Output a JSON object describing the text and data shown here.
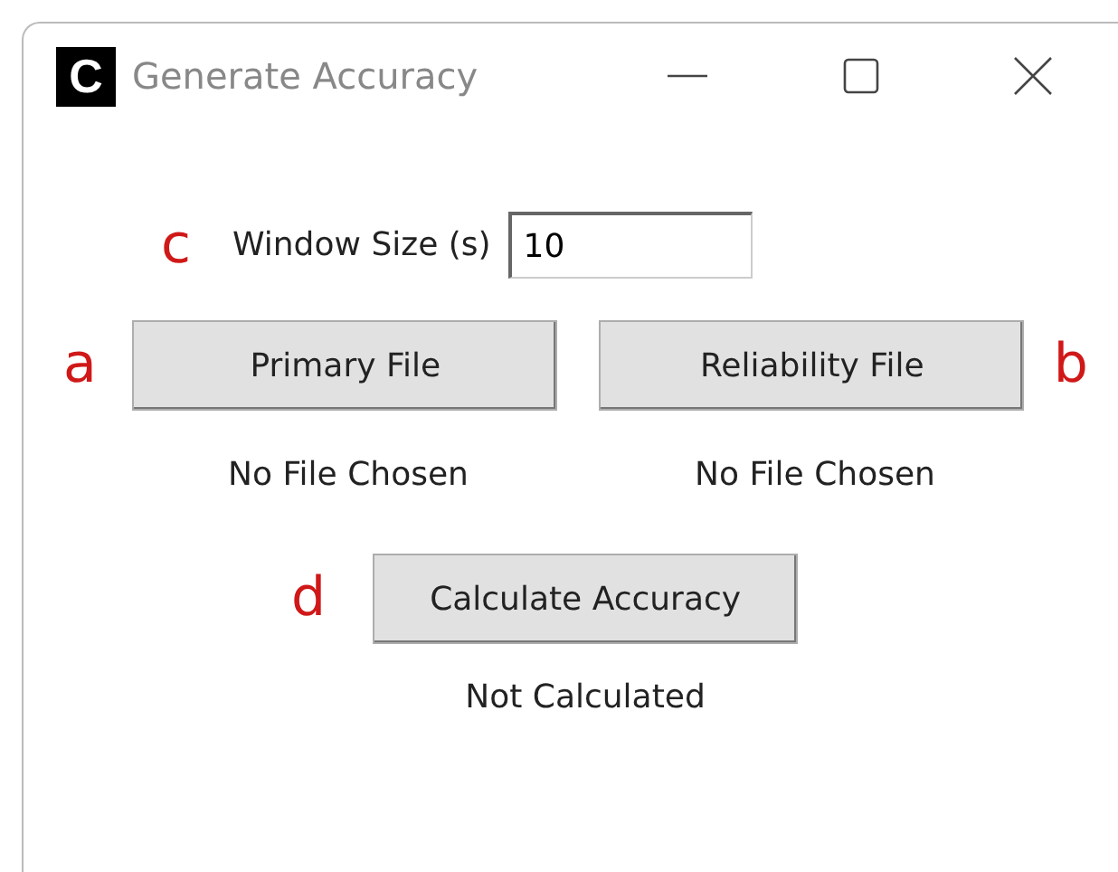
{
  "window": {
    "title": "Generate Accuracy",
    "app_icon_letter": "C"
  },
  "window_size": {
    "annotation": "c",
    "label": "Window Size (s)",
    "value": "10"
  },
  "file_buttons": [
    {
      "annotation": "a",
      "label": "Primary File",
      "status": "No File Chosen"
    },
    {
      "annotation": "b",
      "label": "Reliability File",
      "status": "No File Chosen"
    }
  ],
  "calculate": {
    "annotation": "d",
    "label": "Calculate Accuracy",
    "status": "Not Calculated"
  }
}
